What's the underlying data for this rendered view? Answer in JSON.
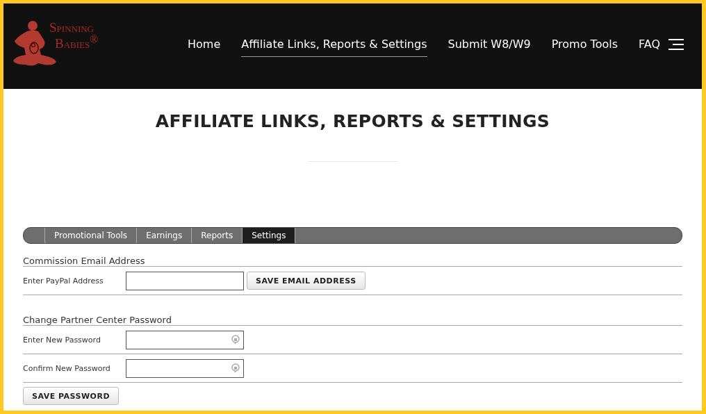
{
  "logo": {
    "lines": [
      "Spinning",
      "Babies$^{®}$"
    ]
  },
  "nav": [
    {
      "label": "Home",
      "selected": false
    },
    {
      "label": "Affiliate Links, Reports & Settings",
      "selected": true
    },
    {
      "label": "Submit W8/W9",
      "selected": false
    },
    {
      "label": "Promo Tools",
      "selected": false
    },
    {
      "label": "FAQ",
      "selected": false
    }
  ],
  "page_title": "AFFILIATE LINKS, REPORTS & SETTINGS",
  "tabs": [
    {
      "label": "Promotional Tools",
      "selected": false
    },
    {
      "label": "Earnings",
      "selected": false
    },
    {
      "label": "Reports",
      "selected": false
    },
    {
      "label": "Settings",
      "selected": true
    }
  ],
  "sections": [
    {
      "heading": "Commission Email Address",
      "rows": [
        {
          "label": "Enter PayPal Address",
          "kind": "text",
          "button": "SAVE EMAIL ADDRESS"
        }
      ]
    },
    {
      "heading": "Change Partner Center Password",
      "rows": [
        {
          "label": "Enter New Password",
          "kind": "password"
        },
        {
          "label": "Confirm New Password",
          "kind": "password"
        }
      ],
      "button": "SAVE PASSWORD"
    }
  ]
}
